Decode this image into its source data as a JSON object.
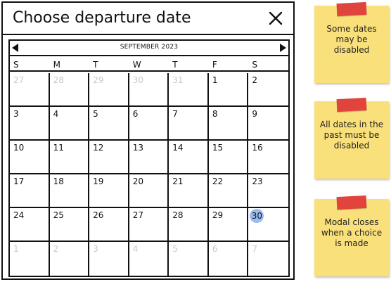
{
  "modal": {
    "title": "Choose departure date",
    "close_icon": "close-icon"
  },
  "calendar": {
    "month_label": "SEPTEMBER 2023",
    "prev_icon": "triangle-left-icon",
    "next_icon": "triangle-right-icon",
    "weekdays": [
      "S",
      "M",
      "T",
      "W",
      "T",
      "F",
      "S"
    ],
    "selected_color": "#9bbcf0",
    "disabled_color": "#c9c9c9",
    "weeks": [
      [
        {
          "d": "27",
          "state": "disabled"
        },
        {
          "d": "28",
          "state": "disabled"
        },
        {
          "d": "29",
          "state": "disabled"
        },
        {
          "d": "30",
          "state": "disabled"
        },
        {
          "d": "31",
          "state": "disabled"
        },
        {
          "d": "1",
          "state": "enabled"
        },
        {
          "d": "2",
          "state": "enabled"
        }
      ],
      [
        {
          "d": "3",
          "state": "enabled"
        },
        {
          "d": "4",
          "state": "enabled"
        },
        {
          "d": "5",
          "state": "enabled"
        },
        {
          "d": "6",
          "state": "enabled"
        },
        {
          "d": "7",
          "state": "enabled"
        },
        {
          "d": "8",
          "state": "enabled"
        },
        {
          "d": "9",
          "state": "enabled"
        }
      ],
      [
        {
          "d": "10",
          "state": "enabled"
        },
        {
          "d": "11",
          "state": "enabled"
        },
        {
          "d": "12",
          "state": "enabled"
        },
        {
          "d": "13",
          "state": "enabled"
        },
        {
          "d": "14",
          "state": "enabled"
        },
        {
          "d": "15",
          "state": "enabled"
        },
        {
          "d": "16",
          "state": "enabled"
        }
      ],
      [
        {
          "d": "17",
          "state": "enabled"
        },
        {
          "d": "18",
          "state": "enabled"
        },
        {
          "d": "19",
          "state": "enabled"
        },
        {
          "d": "20",
          "state": "enabled"
        },
        {
          "d": "21",
          "state": "enabled"
        },
        {
          "d": "22",
          "state": "enabled"
        },
        {
          "d": "23",
          "state": "enabled"
        }
      ],
      [
        {
          "d": "24",
          "state": "enabled"
        },
        {
          "d": "25",
          "state": "enabled"
        },
        {
          "d": "26",
          "state": "enabled"
        },
        {
          "d": "27",
          "state": "enabled"
        },
        {
          "d": "28",
          "state": "enabled"
        },
        {
          "d": "29",
          "state": "enabled"
        },
        {
          "d": "30",
          "state": "selected"
        }
      ],
      [
        {
          "d": "1",
          "state": "disabled"
        },
        {
          "d": "2",
          "state": "disabled"
        },
        {
          "d": "3",
          "state": "disabled"
        },
        {
          "d": "4",
          "state": "disabled"
        },
        {
          "d": "5",
          "state": "disabled"
        },
        {
          "d": "6",
          "state": "disabled"
        },
        {
          "d": "7",
          "state": "disabled"
        }
      ]
    ]
  },
  "notes": [
    {
      "text": "Some dates may be disabled",
      "color": "#fae07a",
      "tape_color": "#e0443c"
    },
    {
      "text": "All dates in the past must be disabled",
      "color": "#fae07a",
      "tape_color": "#e0443c"
    },
    {
      "text": "Modal closes when a choice is made",
      "color": "#fae07a",
      "tape_color": "#e0443c"
    }
  ]
}
